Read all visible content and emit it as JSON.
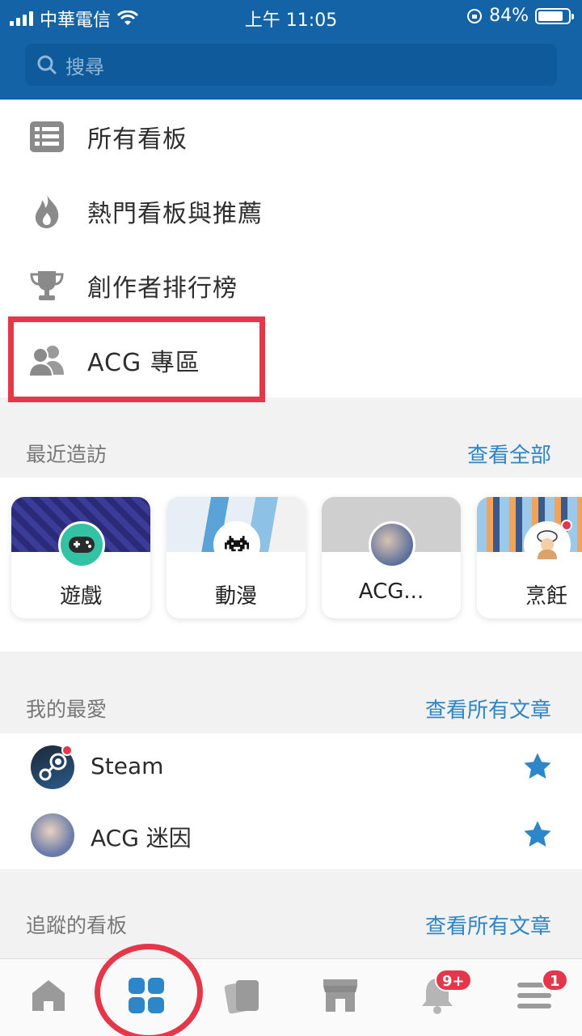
{
  "status_bar": {
    "carrier": "中華電信",
    "time": "上午 11:05",
    "battery": "84%",
    "battery_level": 0.84
  },
  "search": {
    "placeholder": "搜尋"
  },
  "menu": {
    "all_boards": "所有看板",
    "hot_boards": "熱門看板與推薦",
    "creator_rank": "創作者排行榜",
    "acg_zone": "ACG 專區"
  },
  "recent": {
    "title": "最近造訪",
    "link": "查看全部",
    "items": [
      {
        "name": "遊戲"
      },
      {
        "name": "動漫"
      },
      {
        "name": "ACG..."
      },
      {
        "name": "烹飪"
      }
    ]
  },
  "favorites": {
    "title": "我的最愛",
    "link": "查看所有文章",
    "items": [
      {
        "name": "Steam"
      },
      {
        "name": "ACG 迷因"
      }
    ]
  },
  "followed": {
    "title": "追蹤的看板",
    "link": "查看所有文章"
  },
  "bottom_nav": {
    "notifications_badge": "9+",
    "menu_badge": "1"
  },
  "colors": {
    "header": "#1563a7",
    "accent": "#2d86c8",
    "highlight": "#e5364a"
  }
}
